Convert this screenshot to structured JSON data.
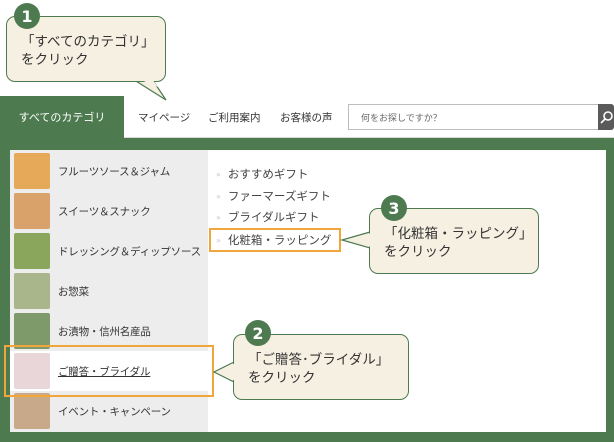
{
  "nav": {
    "all_categories": "すべてのカテゴリ",
    "links": [
      "マイページ",
      "ご利用案内",
      "お客様の声"
    ],
    "search_placeholder": "何をお探しですか？"
  },
  "categories": [
    {
      "label": "フルーツソース＆ジャム",
      "thumb_color": "#e6a95a"
    },
    {
      "label": "スイーツ＆スナック",
      "thumb_color": "#d9a26a"
    },
    {
      "label": "ドレッシング＆ディップソース",
      "thumb_color": "#8aa55c"
    },
    {
      "label": "お惣菜",
      "thumb_color": "#a9b58b"
    },
    {
      "label": "お漬物・信州名産品",
      "thumb_color": "#7f9a6a"
    },
    {
      "label": "ご贈答・ブライダル",
      "thumb_color": "#e9d6d8"
    },
    {
      "label": "イベント・キャンペーン",
      "thumb_color": "#c8a98a"
    }
  ],
  "active_category": "ご贈答・ブライダル",
  "subcategories": [
    "おすすめギフト",
    "ファーマーズギフト",
    "ブライダルギフト",
    "化粧箱・ラッピング"
  ],
  "callouts": [
    {
      "number": "1",
      "line1": "「すべてのカテゴリ」",
      "line2": "をクリック"
    },
    {
      "number": "2",
      "line1": "「ご贈答･ブライダル」",
      "line2": "をクリック"
    },
    {
      "number": "3",
      "line1": "「化粧箱・ラッピング」",
      "line2": "をクリック"
    }
  ],
  "colors": {
    "brand_green": "#4d7a4f",
    "highlight_orange": "#f0a63a",
    "callout_bg": "#f6f0e3"
  }
}
